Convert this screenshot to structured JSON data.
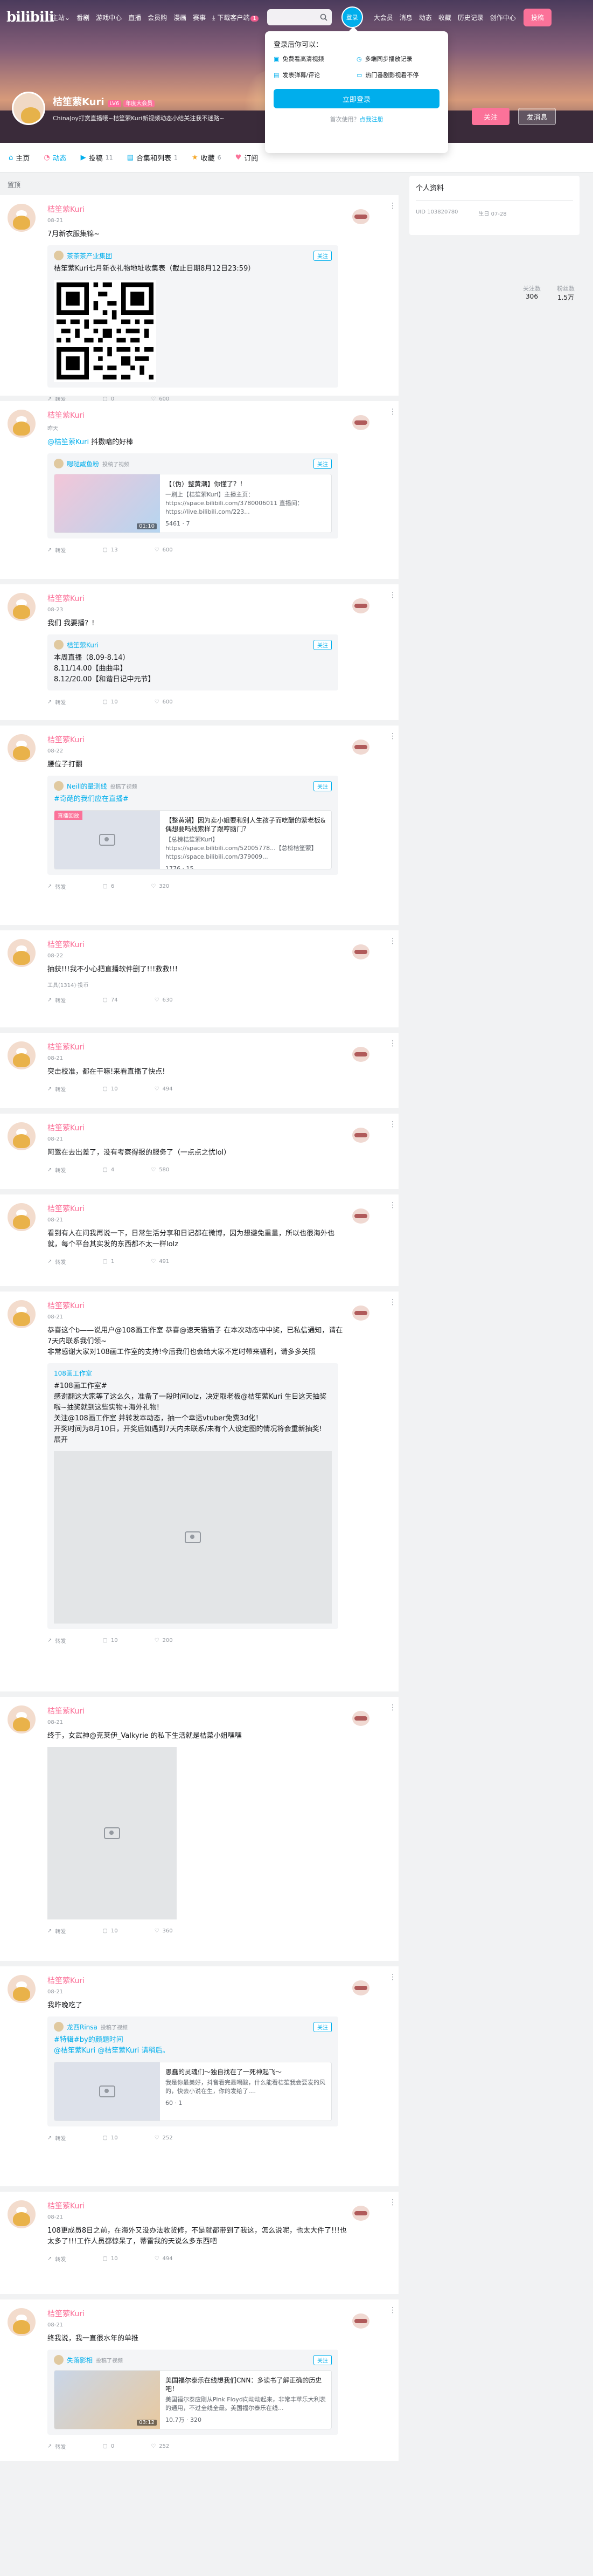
{
  "topbar": {
    "logo": "bilibili",
    "nav": [
      "主站",
      "番剧",
      "游戏中心",
      "直播",
      "会员购",
      "漫画",
      "赛事"
    ],
    "download": "下载客户端",
    "download_badge": "1",
    "login": "登录",
    "right": [
      "大会员",
      "消息",
      "动态",
      "收藏",
      "历史记录",
      "创作中心"
    ],
    "submit": "投稿"
  },
  "profile": {
    "name": "桔笙萦Kuri",
    "level": "LV6",
    "vip": "年度大会员",
    "sign": "ChinaJoy打赏直播哦~桔笙萦Kuri新视频动态小结关注我不迷路~",
    "follow": "关注",
    "message": "发消息"
  },
  "stats": [
    {
      "label": "关注数",
      "value": "306"
    },
    {
      "label": "粉丝数",
      "value": "1.5万"
    }
  ],
  "tabs": [
    {
      "label": "主页",
      "num": ""
    },
    {
      "label": "动态",
      "num": ""
    },
    {
      "label": "投稿",
      "num": "11"
    },
    {
      "label": "合集和列表",
      "num": "1"
    },
    {
      "label": "收藏",
      "num": "6"
    },
    {
      "label": "订阅",
      "num": ""
    }
  ],
  "login_dropdown": {
    "title": "登录后你可以：",
    "features": [
      "免费看高清视频",
      "多端同步播放记录",
      "发表弹幕/评论",
      "热门番剧影视看不停"
    ],
    "button": "立即登录",
    "register_prefix": "首次使用？",
    "register_link": "点我注册"
  },
  "crumb": "置顶",
  "right_panel": {
    "title": "个人资料",
    "uid_label": "UID",
    "uid": "103820780",
    "birthday_label": "生日",
    "birthday": "07-28"
  },
  "actions": {
    "share": "转发",
    "comment": "",
    "like": ""
  },
  "posts": [
    {
      "name": "桔笙萦Kuri",
      "time": "08-21",
      "text": "7月新衣服集锦~",
      "repost": {
        "name": "茶茶茶产业集团",
        "time": "",
        "text": "桔笙萦Kuri七月新衣礼物地址收集表（截止日期8月12日23:59）"
      },
      "stats": [
        "转发",
        "0",
        "600"
      ]
    },
    {
      "name": "桔笙萦Kuri",
      "time": "昨天",
      "text_pre": "",
      "at": "@桔笙萦Kuri",
      "text_post": " 抖擞暗的好棒",
      "repost": {
        "name": "嗯哒咸鱼粉",
        "time": "投稿了视频",
        "card_title": "【（伪）整黄潮】你懂了？！",
        "card_desc": "一刷上【桔笙萦Kuri】主播主页：https://space.bilibili.com/3780006011 直播间：https://live.bilibili.com/223...",
        "card_meta": "5461 · 7"
      },
      "stats": [
        "转发",
        "13",
        "600"
      ]
    },
    {
      "name": "桔笙萦Kuri",
      "time": "08-23",
      "text": "我们 我要播？!",
      "repost": {
        "name": "桔笙萦Kuri",
        "time": "",
        "text": "本周直播（8.09-8.14）\n8.11/14.00【曲曲串】\n8.12/20.00【和谐日记中元节】"
      },
      "stats": [
        "转发",
        "10",
        "600"
      ]
    },
    {
      "name": "桔笙萦Kuri",
      "time": "08-22",
      "text": "腰位子打翻",
      "repost": {
        "name": "Neill的量测线",
        "time": "投稿了视频",
        "extra": "#奇葩的我们应在直播#",
        "card_title": "【整黄潮】因为卖小姐要和别人生孩子而吃醋的萦老板&偶想要吗线索样了跟哼脑门？",
        "card_desc": "【总榜桔笙萦Kuri】https://space.bilibili.com/52005778...【总榜桔笙萦】https://space.bilibili.com/379009...",
        "card_meta": "1776 · 15"
      },
      "stats": [
        "转发",
        "6",
        "320"
      ]
    },
    {
      "name": "桔笙萦Kuri",
      "time": "08-22",
      "text": "抽获!!!我不小心把直播软件删了!!!救救!!!",
      "extra": "工具(1314)·投币",
      "stats": [
        "转发",
        "74",
        "630"
      ]
    },
    {
      "name": "桔笙萦Kuri",
      "time": "08-21",
      "text": "突击校准，都在干嘛!来看直播了快点!",
      "stats": [
        "转发",
        "10",
        "494"
      ]
    },
    {
      "name": "桔笙萦Kuri",
      "time": "08-21",
      "text": "阿鹭在去出差了，没有考察得报的服务了（一点点之忧lol）",
      "stats": [
        "转发",
        "4",
        "580"
      ]
    },
    {
      "name": "桔笙萦Kuri",
      "time": "08-21",
      "text": "看到有人在问我再说一下，日常生活分享和日记都在微博，因为想避免重量，所以也很海外也就，每个平台其实发的东西都不太一样lolz",
      "stats": [
        "转发",
        "1",
        "491"
      ]
    },
    {
      "name": "桔笙萦Kuri",
      "time": "08-21",
      "text": "恭喜这个b——说用户@108画工作室 恭喜@速天猫猫子 在本次动态中中奖，已私信通知，请在7天内联系我们领~\n非常感谢大家对108画工作室的支持!今后我们也会给大家不定时带来福利，请多多关照",
      "repost": {
        "name": "108画工作室",
        "time": "",
        "text": "#108画工作室#\n感谢翻这大家等了这么久，准备了一段时间lolz，决定取老板@桔笙萦Kuri 生日这天抽奖啦~抽奖就到这些实物+海外礼物!\n关注@108画工作室 并转发本动态，抽一个幸运vtuber免费3d化！\n开奖时间为8月10日，开奖后如遇到7天内未联系/未有个人设定图的情况将会重新抽奖!\n展开"
      },
      "stats": [
        "转发",
        "10",
        "200"
      ]
    },
    {
      "name": "桔笙萦Kuri",
      "time": "08-21",
      "text": "终于，女武神@克莱伊_Valkyrie 的私下生活就是桔菜小姐嘿嘿",
      "stats": [
        "转发",
        "10",
        "360"
      ]
    },
    {
      "name": "桔笙萦Kuri",
      "time": "08-21",
      "text": "我昨晚吃了",
      "repost": {
        "name": "龙西Rinsa",
        "time": "投稿了视频",
        "extra": "#特辑#by的颜题时间\n@桔笙萦Kuri @桔笙萦Kuri 请稍后。",
        "card_title": "愚蠢的灵魂们～独自找在了一死神起飞～",
        "card_desc": "我是你最美好，抖音看完最喝酸，什么能看桔笙我会要发的风的，快去小说在生，你的发给了....",
        "card_meta": "60 · 1"
      },
      "stats": [
        "转发",
        "10",
        "252"
      ]
    },
    {
      "name": "桔笙萦Kuri",
      "time": "08-21",
      "text": "108更成员8日之前，在海外又没办法收货修，不是就都带到了我这，怎么说呢，也太大件了!!!也太多了!!!工作人员都惊呆了，蒂雷我的天说么多东西吧",
      "stats": [
        "转发",
        "10",
        "494"
      ]
    },
    {
      "name": "桔笙萦Kuri",
      "time": "08-21",
      "text": "终我说，我一直很水年的单推",
      "repost": {
        "name": "失落影相",
        "time": "投稿了视频",
        "card_title": "美国福尔泰乐在线想我们CNN：多读书了解正确的历史吧！",
        "card_desc": "美国福尔泰应刚从Pink Floyd向动动起来，非常丰苹乐大利表的通用，不过全线全最。美国福尔泰乐在线...",
        "card_meta": "10.7万 · 320"
      },
      "stats": [
        "转发",
        "0",
        "252"
      ]
    }
  ]
}
